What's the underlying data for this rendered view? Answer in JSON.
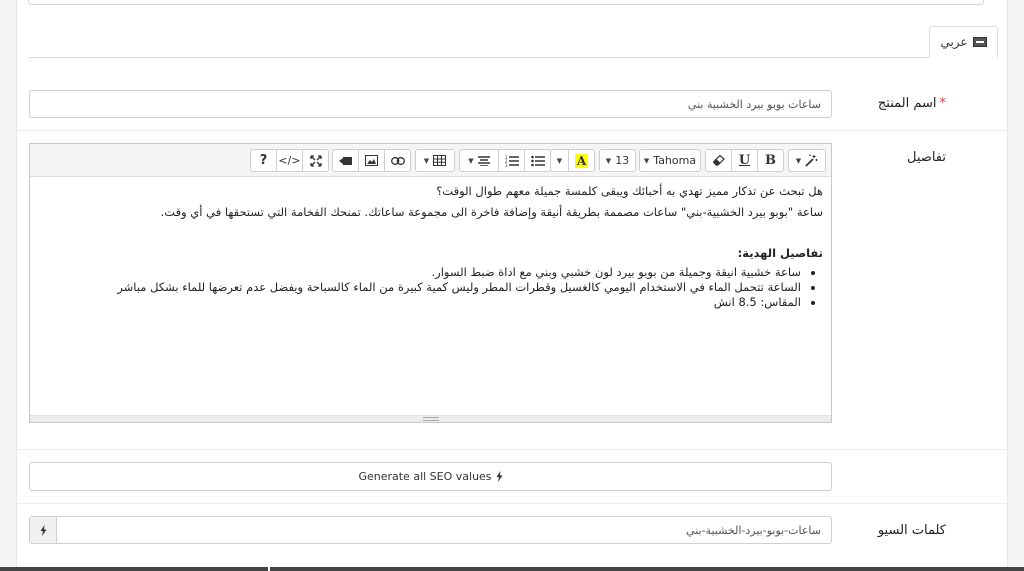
{
  "tabs": {
    "language": "عربي",
    "language_icon": "keyboard-icon"
  },
  "product_name": {
    "label": "اسم المنتج",
    "required_mark": "*",
    "value": "ساعات بوبو بيرد الخشبية بني"
  },
  "details": {
    "label": "تفاصيل",
    "toolbar": {
      "font_name": "Tahoma",
      "font_size": "13",
      "bold": "B",
      "underline": "U",
      "highlight": "A",
      "code": "</>",
      "help": "?"
    },
    "content": {
      "line1": "هل تبحث عن تذكار مميز تهدي به أحبائك ويبقى كلمسة جميلة معهم طوال الوقت؟",
      "line2": "ساعة \"بوبو بيرد الخشبية-بني\" ساعات مصممة بطريقة أنيقة وإضافة فاخرة الى مجموعة ساعاتك. تمنحك الفخامة التي تستحقها في أي وقت.",
      "heading": "تفاصيل الهدية:",
      "bullets": [
        "ساعة خشبية انيقة وجميلة من بوبو بيرد لون خشبي وبني مع اداة ضبط السوار.",
        "الساعة تتحمل الماء في الاستخدام اليومي كالغسيل وقطرات المطر وليس كمية كبيرة من الماء كالسباحة ويفضل عدم تعرضها للماء بشكل مباشر",
        "المقاس: 8.5 انش"
      ]
    }
  },
  "seo": {
    "generate_label": "Generate all SEO values",
    "generate_icon": "bolt-icon"
  },
  "keywords": {
    "label": "كلمات السيو",
    "value": "ساعات-بوبو-بيرد-الخشبية-بني",
    "addon_icon": "bolt-icon"
  }
}
